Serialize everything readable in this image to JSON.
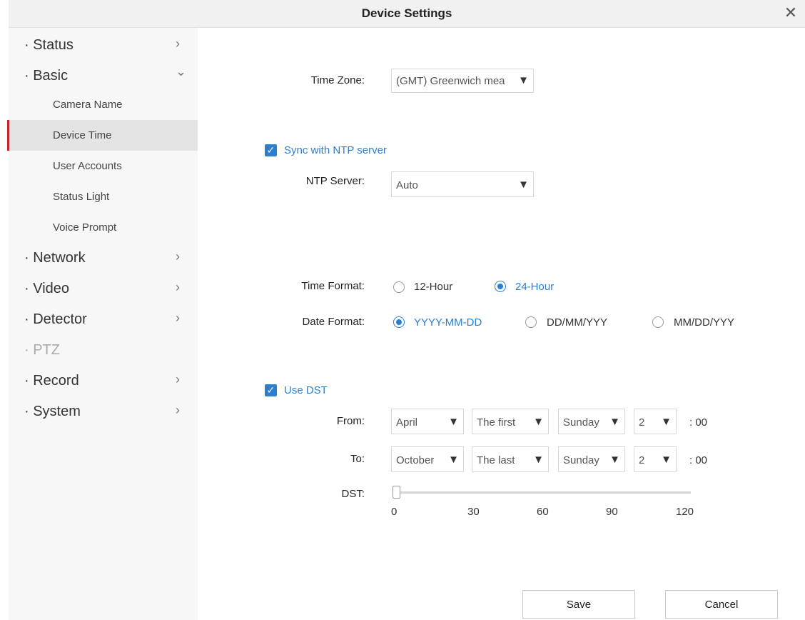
{
  "window": {
    "title": "Device Settings",
    "close_glyph": "✕"
  },
  "sidebar": {
    "chevron_right": "›",
    "chevron_down": "⌄",
    "items": [
      {
        "label": "· Status"
      },
      {
        "label": "· Basic"
      },
      {
        "label": "· Network"
      },
      {
        "label": "· Video"
      },
      {
        "label": "· Detector"
      },
      {
        "label": "· PTZ"
      },
      {
        "label": "· Record"
      },
      {
        "label": "· System"
      }
    ],
    "basic_sub": [
      {
        "label": "Camera Name"
      },
      {
        "label": "Device Time"
      },
      {
        "label": "User Accounts"
      },
      {
        "label": "Status Light"
      },
      {
        "label": "Voice Prompt"
      }
    ]
  },
  "form": {
    "time_zone_label": "Time Zone:",
    "time_zone_value": "(GMT) Greenwich mea",
    "sync_ntp_label": "Sync with NTP server",
    "ntp_server_label": "NTP Server:",
    "ntp_server_value": "Auto",
    "time_format_label": "Time Format:",
    "time_format_options": [
      "12-Hour",
      "24-Hour"
    ],
    "date_format_label": "Date Format:",
    "date_format_options": [
      "YYYY-MM-DD",
      "DD/MM/YYY",
      "MM/DD/YYY"
    ],
    "use_dst_label": "Use DST",
    "from_label": "From:",
    "to_label": "To:",
    "from": {
      "month": "April",
      "week": "The first",
      "day": "Sunday",
      "hour": "2",
      "suffix": ": 00"
    },
    "to": {
      "month": "October",
      "week": "The last",
      "day": "Sunday",
      "hour": "2",
      "suffix": ": 00"
    },
    "dst_label": "DST:",
    "dst_ticks": [
      "0",
      "30",
      "60",
      "90",
      "120"
    ],
    "dst_value": 0,
    "arrow": "▼",
    "check": "✓"
  },
  "buttons": {
    "save": "Save",
    "cancel": "Cancel"
  },
  "colors": {
    "accent": "#2b7fd0",
    "active_marker": "#c0262d"
  }
}
